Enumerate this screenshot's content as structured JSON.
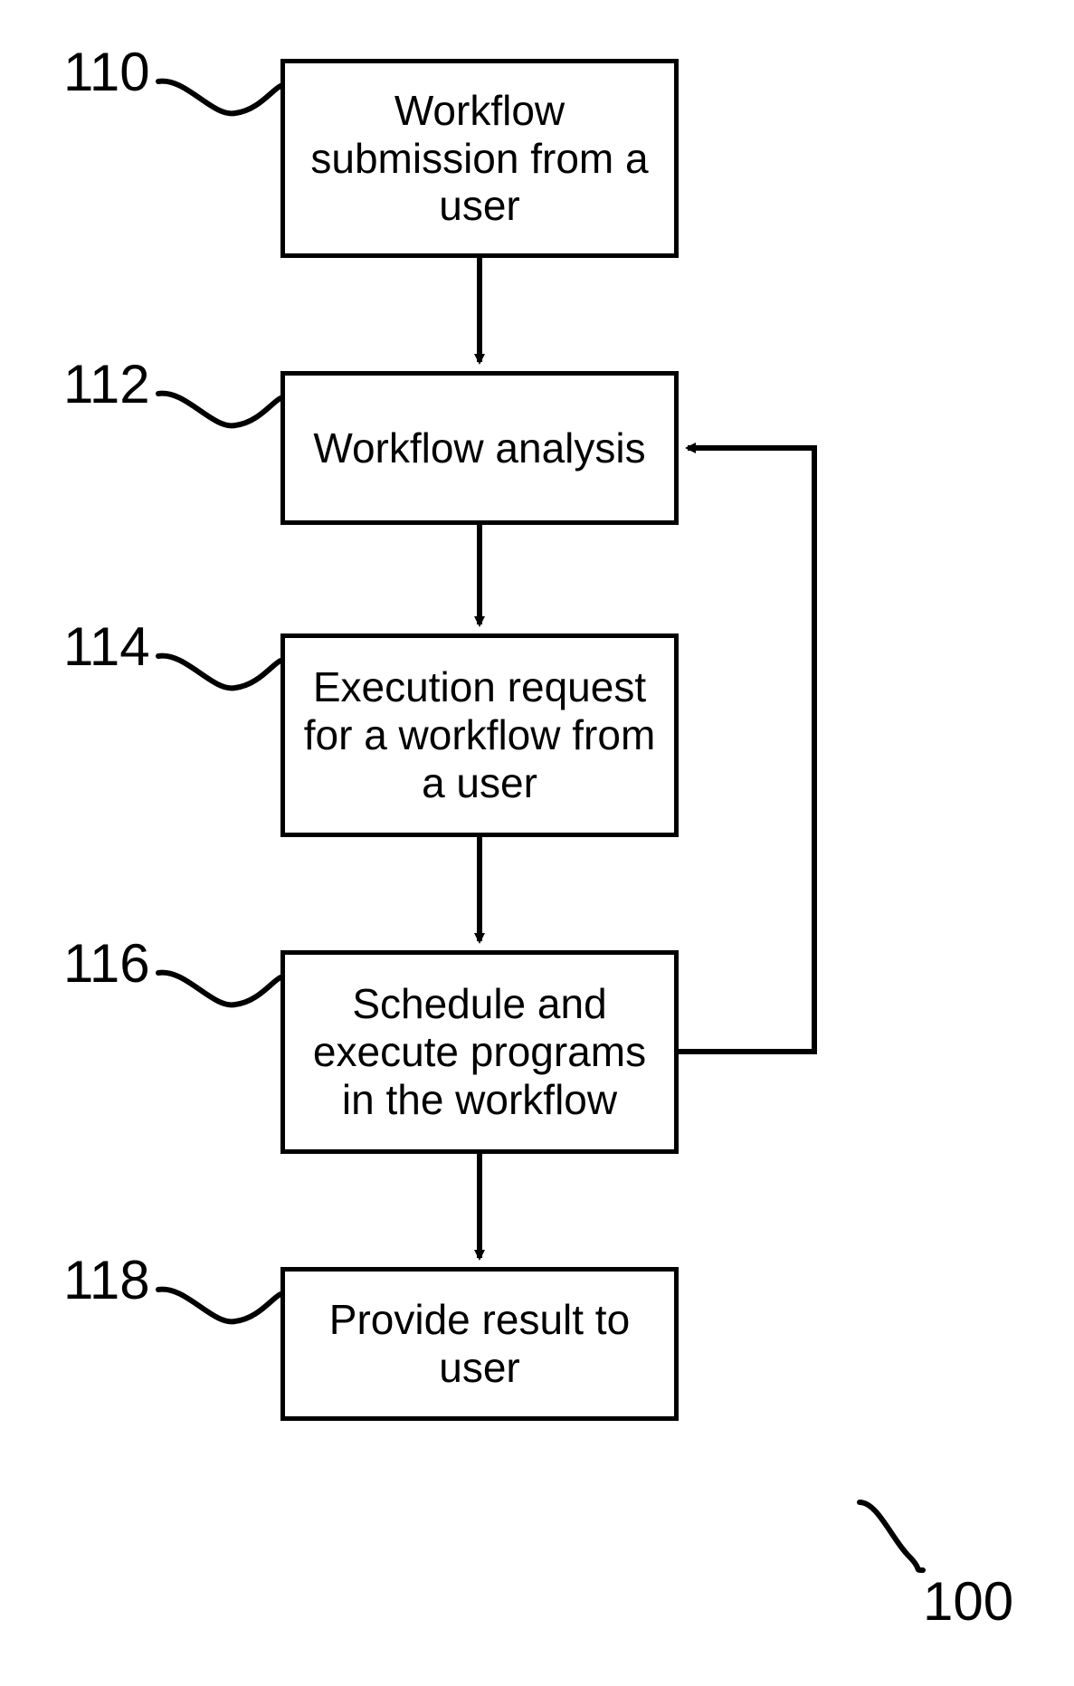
{
  "diagram": {
    "id_label": "100",
    "nodes": {
      "n110": {
        "ref": "110",
        "text": "Workflow submission from a user"
      },
      "n112": {
        "ref": "112",
        "text": "Workflow analysis"
      },
      "n114": {
        "ref": "114",
        "text": "Execution request for a workflow from a user"
      },
      "n116": {
        "ref": "116",
        "text": "Schedule and execute programs in the workflow"
      },
      "n118": {
        "ref": "118",
        "text": "Provide result to user"
      }
    }
  }
}
